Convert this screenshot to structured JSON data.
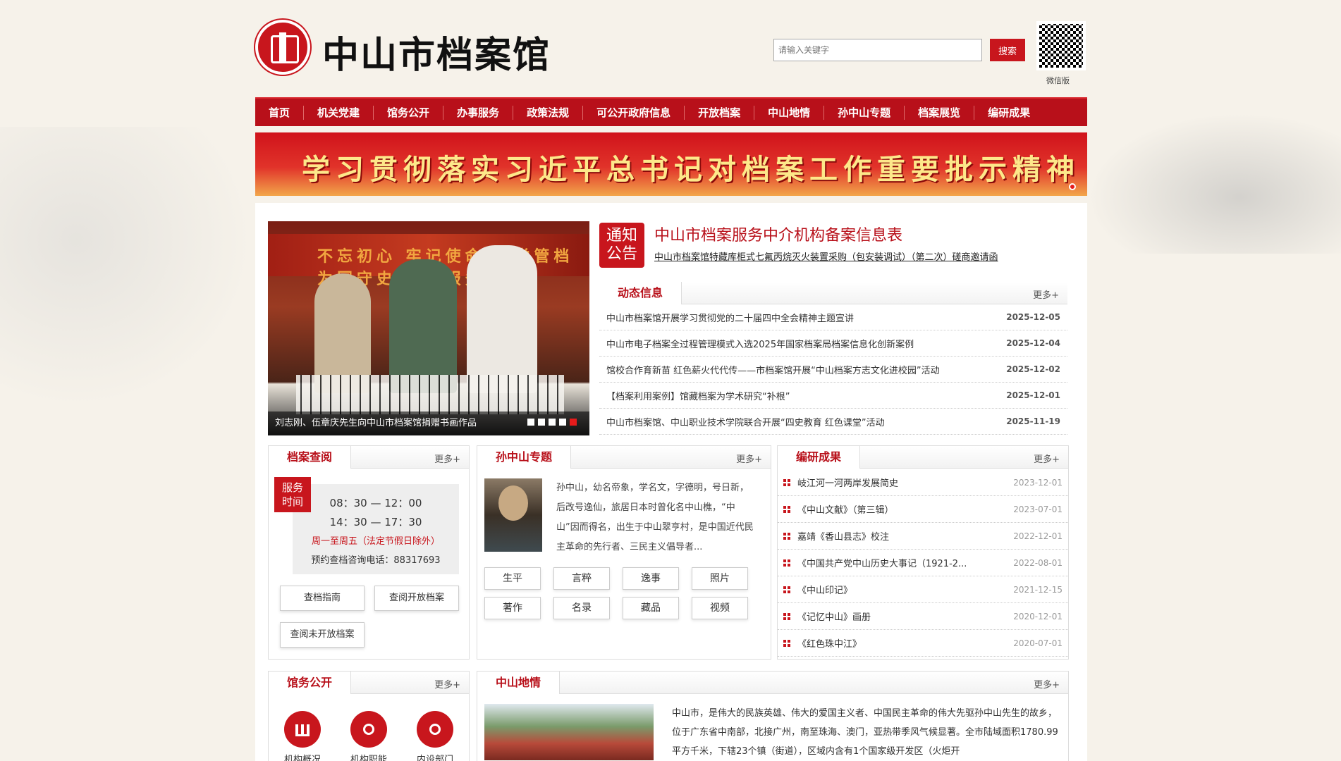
{
  "header": {
    "site_title": "中山市档案馆",
    "search_placeholder": "请输入关键字",
    "search_button": "搜索",
    "qr_label": "微信版"
  },
  "nav": [
    "首页",
    "机关党建",
    "馆务公开",
    "办事服务",
    "政策法规",
    "可公开政府信息",
    "开放档案",
    "中山地情",
    "孙中山专题",
    "档案展览",
    "编研成果"
  ],
  "banner": {
    "text": "学习贯彻落实习近平总书记对档案工作重要批示精神"
  },
  "slider": {
    "banner_text": "不忘初心 牢记使命 为党管档 为国守史 为民服务",
    "caption": "刘志刚、伍章庆先生向中山市档案馆捐赠书画作品",
    "dots": 5,
    "active_dot": 5
  },
  "notice": {
    "badge_line1": "通知",
    "badge_line2": "公告",
    "title": "中山市档案服务中介机构备案信息表",
    "subtitle": "中山市档案馆特藏库柜式七氟丙烷灭火装置采购（包安装调试）（第二次）磋商邀请函"
  },
  "news": {
    "title": "动态信息",
    "more": "更多+",
    "items": [
      {
        "text": "中山市档案馆开展学习贯彻党的二十届四中全会精神主题宣讲",
        "date": "2025-12-05"
      },
      {
        "text": "中山市电子档案全过程管理模式入选2025年国家档案局档案信息化创新案例",
        "date": "2025-12-04"
      },
      {
        "text": "馆校合作育新苗 红色薪火代代传——市档案馆开展“中山档案方志文化进校园”活动",
        "date": "2025-12-02"
      },
      {
        "text": "【档案利用案例】馆藏档案为学术研究“补根”",
        "date": "2025-12-01"
      },
      {
        "text": "中山市档案馆、中山职业技术学院联合开展“四史教育 红色课堂”活动",
        "date": "2025-11-19"
      }
    ]
  },
  "archive_query": {
    "title": "档案查阅",
    "more": "更多+",
    "badge_line1": "服务",
    "badge_line2": "时间",
    "time1": "08：30 — 12：00",
    "time2": "14：30 — 17：30",
    "note": "周一至周五（法定节假日除外）",
    "tel": "预约查档咨询电话：88317693",
    "buttons": [
      "查档指南",
      "查阅开放档案",
      "查阅未开放档案"
    ]
  },
  "sun_topic": {
    "title": "孙中山专题",
    "more": "更多+",
    "text": "孙中山，幼名帝象，学名文，字德明，号日新，后改号逸仙，旅居日本时曾化名中山樵，“中山”因而得名，出生于中山翠亨村，是中国近代民主革命的先行者、三民主义倡导者...",
    "tags": [
      "生平",
      "言粹",
      "逸事",
      "照片",
      "著作",
      "名录",
      "藏品",
      "视频"
    ]
  },
  "research": {
    "title": "编研成果",
    "more": "更多+",
    "items": [
      {
        "text": "岐江河一河两岸发展简史",
        "date": "2023-12-01"
      },
      {
        "text": "《中山文献》（第三辑）",
        "date": "2023-07-01"
      },
      {
        "text": "嘉靖《香山县志》校注",
        "date": "2022-12-01"
      },
      {
        "text": "《中国共产党中山历史大事记（1921-2...",
        "date": "2022-08-01"
      },
      {
        "text": "《中山印记》",
        "date": "2021-12-15"
      },
      {
        "text": "《记忆中山》画册",
        "date": "2020-12-01"
      },
      {
        "text": "《红色珠中江》",
        "date": "2020-07-01"
      }
    ]
  },
  "affairs": {
    "title": "馆务公开",
    "more": "更多+",
    "items": [
      "机构概况",
      "机构职能",
      "内设部门"
    ]
  },
  "zhongshan": {
    "title": "中山地情",
    "more": "更多+",
    "text": "中山市，是伟大的民族英雄、伟大的爱国主义者、中国民主革命的伟大先驱孙中山先生的故乡，位于广东省中南部，北接广州，南至珠海、澳门，亚热带季风气候显著。全市陆域面积1780.99平方千米，下辖23个镇（街道），区域内含有1个国家级开发区（火炬开"
  }
}
